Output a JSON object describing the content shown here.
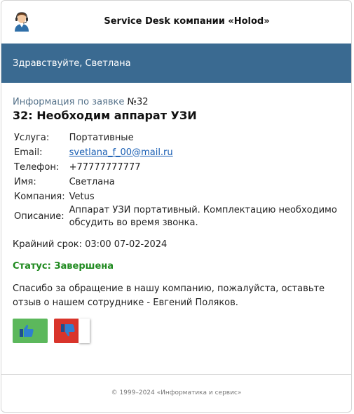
{
  "header": {
    "title": "Service Desk компании «Holod»"
  },
  "banner": {
    "greeting": "Здравствуйте, Светлана"
  },
  "request": {
    "subtitle_prefix": "Информация по заявке ",
    "subtitle_number": "№32",
    "title": "32: Необходим аппарат УЗИ",
    "fields": {
      "service_label": "Услуга:",
      "service_value": "Портативные",
      "email_label": "Email:",
      "email_value": "svetlana_f_00@mail.ru",
      "phone_label": "Телефон:",
      "phone_value": "+77777777777",
      "name_label": "Имя:",
      "name_value": "Светлана",
      "company_label": "Компания:",
      "company_value": "Vetus",
      "description_label": "Описание:",
      "description_value": "Аппарат УЗИ портативный. Комплектацию необходимо обсудить во время звонка."
    },
    "deadline": "Крайний срок: 03:00 07-02-2024",
    "status": "Статус: Завершена",
    "thanks": "Спасибо за обращение в нашу компанию, пожалуйста, оставьте отзыв о нашем сотруднике - Евгений Поляков."
  },
  "icons": {
    "avatar": "support-agent-icon",
    "like": "thumbs-up-icon",
    "dislike": "thumbs-down-icon"
  },
  "colors": {
    "banner": "#3a6a91",
    "status": "#1f8a1f",
    "like": "#5cb85c",
    "dislike": "#d9342b",
    "link": "#1a5fb4"
  },
  "footer": {
    "copyright": "© 1999–2024 «Информатика и сервис»"
  }
}
